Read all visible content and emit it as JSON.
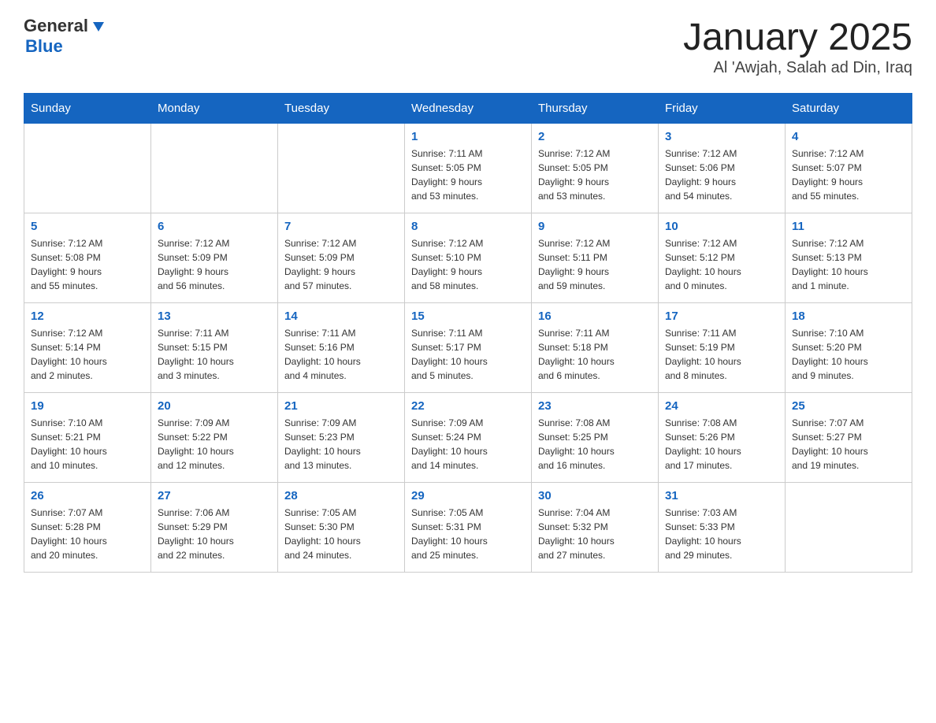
{
  "header": {
    "logo_general": "General",
    "logo_blue": "Blue",
    "title": "January 2025",
    "subtitle": "Al 'Awjah, Salah ad Din, Iraq"
  },
  "days_of_week": [
    "Sunday",
    "Monday",
    "Tuesday",
    "Wednesday",
    "Thursday",
    "Friday",
    "Saturday"
  ],
  "weeks": [
    [
      {
        "day": "",
        "info": ""
      },
      {
        "day": "",
        "info": ""
      },
      {
        "day": "",
        "info": ""
      },
      {
        "day": "1",
        "info": "Sunrise: 7:11 AM\nSunset: 5:05 PM\nDaylight: 9 hours\nand 53 minutes."
      },
      {
        "day": "2",
        "info": "Sunrise: 7:12 AM\nSunset: 5:05 PM\nDaylight: 9 hours\nand 53 minutes."
      },
      {
        "day": "3",
        "info": "Sunrise: 7:12 AM\nSunset: 5:06 PM\nDaylight: 9 hours\nand 54 minutes."
      },
      {
        "day": "4",
        "info": "Sunrise: 7:12 AM\nSunset: 5:07 PM\nDaylight: 9 hours\nand 55 minutes."
      }
    ],
    [
      {
        "day": "5",
        "info": "Sunrise: 7:12 AM\nSunset: 5:08 PM\nDaylight: 9 hours\nand 55 minutes."
      },
      {
        "day": "6",
        "info": "Sunrise: 7:12 AM\nSunset: 5:09 PM\nDaylight: 9 hours\nand 56 minutes."
      },
      {
        "day": "7",
        "info": "Sunrise: 7:12 AM\nSunset: 5:09 PM\nDaylight: 9 hours\nand 57 minutes."
      },
      {
        "day": "8",
        "info": "Sunrise: 7:12 AM\nSunset: 5:10 PM\nDaylight: 9 hours\nand 58 minutes."
      },
      {
        "day": "9",
        "info": "Sunrise: 7:12 AM\nSunset: 5:11 PM\nDaylight: 9 hours\nand 59 minutes."
      },
      {
        "day": "10",
        "info": "Sunrise: 7:12 AM\nSunset: 5:12 PM\nDaylight: 10 hours\nand 0 minutes."
      },
      {
        "day": "11",
        "info": "Sunrise: 7:12 AM\nSunset: 5:13 PM\nDaylight: 10 hours\nand 1 minute."
      }
    ],
    [
      {
        "day": "12",
        "info": "Sunrise: 7:12 AM\nSunset: 5:14 PM\nDaylight: 10 hours\nand 2 minutes."
      },
      {
        "day": "13",
        "info": "Sunrise: 7:11 AM\nSunset: 5:15 PM\nDaylight: 10 hours\nand 3 minutes."
      },
      {
        "day": "14",
        "info": "Sunrise: 7:11 AM\nSunset: 5:16 PM\nDaylight: 10 hours\nand 4 minutes."
      },
      {
        "day": "15",
        "info": "Sunrise: 7:11 AM\nSunset: 5:17 PM\nDaylight: 10 hours\nand 5 minutes."
      },
      {
        "day": "16",
        "info": "Sunrise: 7:11 AM\nSunset: 5:18 PM\nDaylight: 10 hours\nand 6 minutes."
      },
      {
        "day": "17",
        "info": "Sunrise: 7:11 AM\nSunset: 5:19 PM\nDaylight: 10 hours\nand 8 minutes."
      },
      {
        "day": "18",
        "info": "Sunrise: 7:10 AM\nSunset: 5:20 PM\nDaylight: 10 hours\nand 9 minutes."
      }
    ],
    [
      {
        "day": "19",
        "info": "Sunrise: 7:10 AM\nSunset: 5:21 PM\nDaylight: 10 hours\nand 10 minutes."
      },
      {
        "day": "20",
        "info": "Sunrise: 7:09 AM\nSunset: 5:22 PM\nDaylight: 10 hours\nand 12 minutes."
      },
      {
        "day": "21",
        "info": "Sunrise: 7:09 AM\nSunset: 5:23 PM\nDaylight: 10 hours\nand 13 minutes."
      },
      {
        "day": "22",
        "info": "Sunrise: 7:09 AM\nSunset: 5:24 PM\nDaylight: 10 hours\nand 14 minutes."
      },
      {
        "day": "23",
        "info": "Sunrise: 7:08 AM\nSunset: 5:25 PM\nDaylight: 10 hours\nand 16 minutes."
      },
      {
        "day": "24",
        "info": "Sunrise: 7:08 AM\nSunset: 5:26 PM\nDaylight: 10 hours\nand 17 minutes."
      },
      {
        "day": "25",
        "info": "Sunrise: 7:07 AM\nSunset: 5:27 PM\nDaylight: 10 hours\nand 19 minutes."
      }
    ],
    [
      {
        "day": "26",
        "info": "Sunrise: 7:07 AM\nSunset: 5:28 PM\nDaylight: 10 hours\nand 20 minutes."
      },
      {
        "day": "27",
        "info": "Sunrise: 7:06 AM\nSunset: 5:29 PM\nDaylight: 10 hours\nand 22 minutes."
      },
      {
        "day": "28",
        "info": "Sunrise: 7:05 AM\nSunset: 5:30 PM\nDaylight: 10 hours\nand 24 minutes."
      },
      {
        "day": "29",
        "info": "Sunrise: 7:05 AM\nSunset: 5:31 PM\nDaylight: 10 hours\nand 25 minutes."
      },
      {
        "day": "30",
        "info": "Sunrise: 7:04 AM\nSunset: 5:32 PM\nDaylight: 10 hours\nand 27 minutes."
      },
      {
        "day": "31",
        "info": "Sunrise: 7:03 AM\nSunset: 5:33 PM\nDaylight: 10 hours\nand 29 minutes."
      },
      {
        "day": "",
        "info": ""
      }
    ]
  ]
}
